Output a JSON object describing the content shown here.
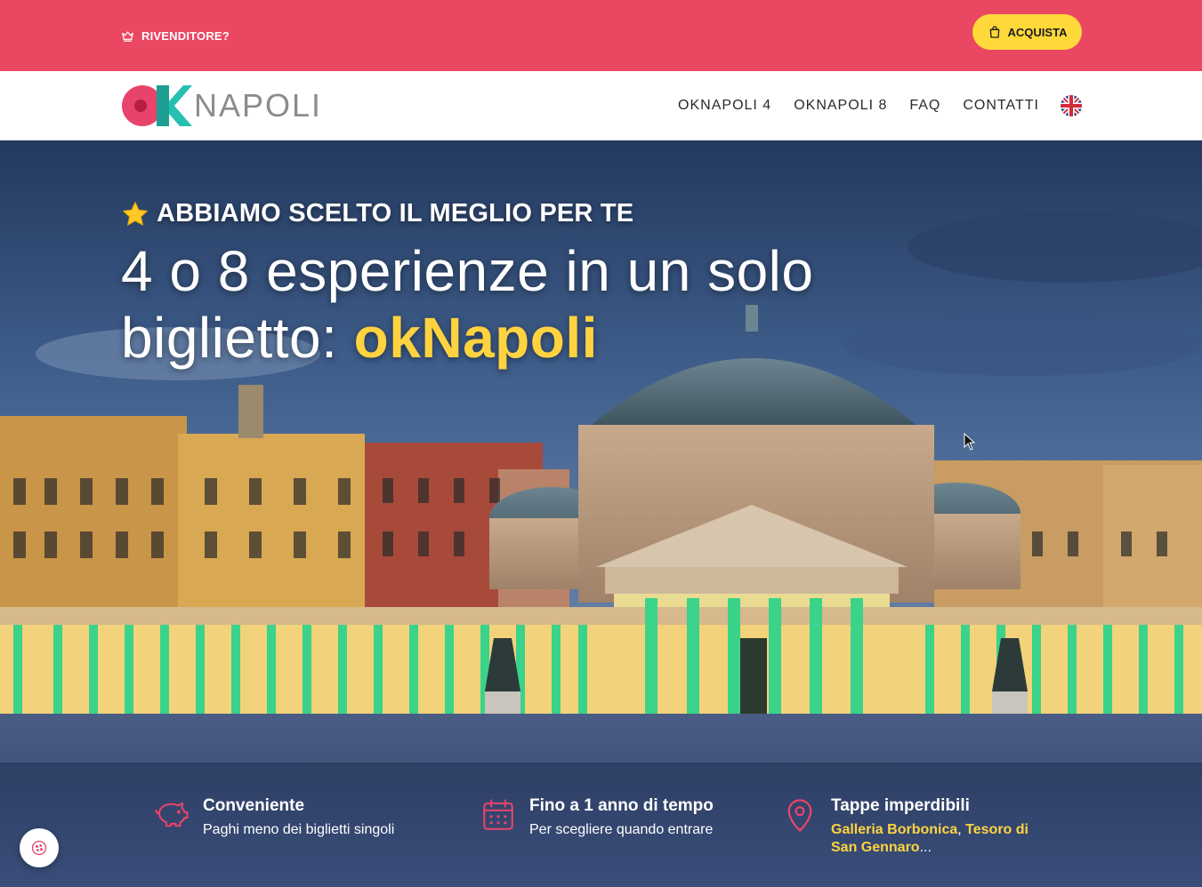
{
  "colors": {
    "topbar": "#ea4763",
    "accent_yellow": "#ffd83a",
    "brand_pink": "#e8436a",
    "brand_teal": "#27c0b0"
  },
  "topbar": {
    "reseller_label": "RIVENDITORE?",
    "reseller_icon": "crown-icon",
    "buy_label": "ACQUISTA",
    "buy_icon": "shopping-bag-icon"
  },
  "nav": {
    "logo_text": "NAPOLI",
    "links": [
      "OKNAPOLI 4",
      "OKNAPOLI 8",
      "FAQ",
      "CONTATTI"
    ],
    "language_icon": "uk-flag-icon"
  },
  "hero": {
    "eyebrow": "ABBIAMO SCELTO IL MEGLIO PER TE",
    "eyebrow_icon": "star-icon",
    "headline_line1": "4 o 8 esperienze in un solo",
    "headline_line2_prefix": "biglietto: ",
    "headline_brand": "okNapoli"
  },
  "features": [
    {
      "icon": "piggy-bank-icon",
      "title": "Conveniente",
      "subtitle": "Paghi meno dei biglietti singoli"
    },
    {
      "icon": "calendar-icon",
      "title": "Fino a 1 anno di tempo",
      "subtitle": "Per scegliere quando entrare"
    },
    {
      "icon": "map-pin-icon",
      "title": "Tappe imperdibili",
      "link1": "Galleria Borbonica",
      "sep": ", ",
      "link2": "Tesoro di San Gennaro",
      "ellipsis": "..."
    }
  ],
  "cookie_icon": "cookie-icon"
}
